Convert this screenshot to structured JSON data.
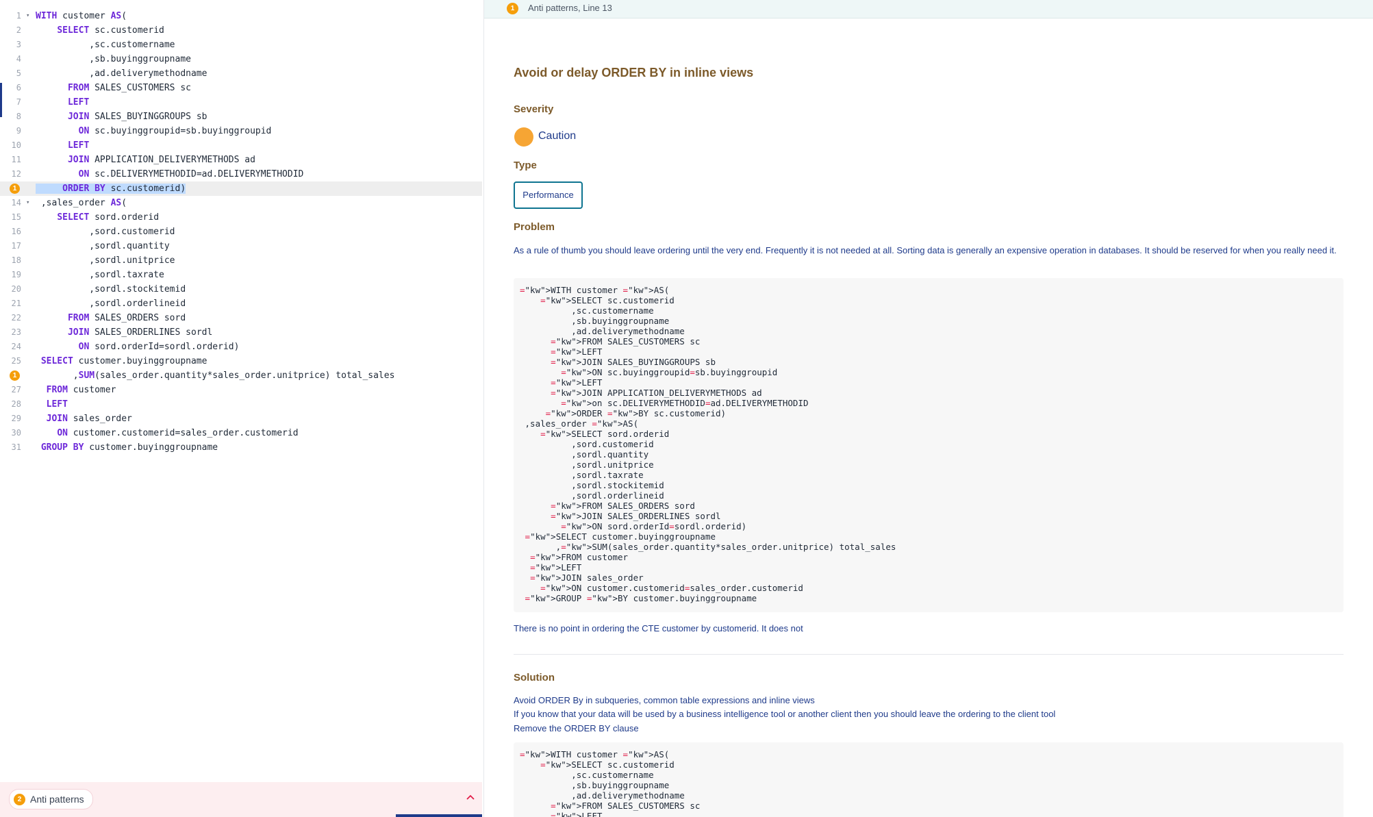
{
  "editor": {
    "lines": [
      {
        "n": "1",
        "code": "WITH customer AS(",
        "fold": true
      },
      {
        "n": "2",
        "code": "    SELECT sc.customerid"
      },
      {
        "n": "3",
        "code": "          ,sc.customername"
      },
      {
        "n": "4",
        "code": "          ,sb.buyinggroupname"
      },
      {
        "n": "5",
        "code": "          ,ad.deliverymethodname"
      },
      {
        "n": "6",
        "code": "      FROM SALES_CUSTOMERS sc"
      },
      {
        "n": "7",
        "code": "      LEFT"
      },
      {
        "n": "8",
        "code": "      JOIN SALES_BUYINGGROUPS sb"
      },
      {
        "n": "9",
        "code": "        ON sc.buyinggroupid=sb.buyinggroupid"
      },
      {
        "n": "10",
        "code": "      LEFT"
      },
      {
        "n": "11",
        "code": "      JOIN APPLICATION_DELIVERYMETHODS ad"
      },
      {
        "n": "12",
        "code": "        ON sc.DELIVERYMETHODID=ad.DELIVERYMETHODID"
      },
      {
        "n": "",
        "code": "     ORDER BY sc.customerid)",
        "warn": "1",
        "hl": true
      },
      {
        "n": "14",
        "code": " ,sales_order AS(",
        "fold": true
      },
      {
        "n": "15",
        "code": "    SELECT sord.orderid"
      },
      {
        "n": "16",
        "code": "          ,sord.customerid"
      },
      {
        "n": "17",
        "code": "          ,sordl.quantity"
      },
      {
        "n": "18",
        "code": "          ,sordl.unitprice"
      },
      {
        "n": "19",
        "code": "          ,sordl.taxrate"
      },
      {
        "n": "20",
        "code": "          ,sordl.stockitemid"
      },
      {
        "n": "21",
        "code": "          ,sordl.orderlineid"
      },
      {
        "n": "22",
        "code": "      FROM SALES_ORDERS sord"
      },
      {
        "n": "23",
        "code": "      JOIN SALES_ORDERLINES sordl"
      },
      {
        "n": "24",
        "code": "        ON sord.orderId=sordl.orderid)"
      },
      {
        "n": "25",
        "code": " SELECT customer.buyinggroupname"
      },
      {
        "n": "",
        "code": "       ,SUM(sales_order.quantity*sales_order.unitprice) total_sales",
        "warn": "1"
      },
      {
        "n": "27",
        "code": "  FROM customer"
      },
      {
        "n": "28",
        "code": "  LEFT"
      },
      {
        "n": "29",
        "code": "  JOIN sales_order"
      },
      {
        "n": "30",
        "code": "    ON customer.customerid=sales_order.customerid"
      },
      {
        "n": "31",
        "code": " GROUP BY customer.buyinggroupname"
      }
    ]
  },
  "bottom": {
    "badge": "2",
    "label": "Anti patterns",
    "collapse_icon": "chevron-up-icon"
  },
  "detail": {
    "header": {
      "badge": "1",
      "text": "Anti patterns, Line 13"
    },
    "title": "Avoid or delay ORDER BY in inline views",
    "severity_heading": "Severity",
    "severity_label": "Caution",
    "severity_color": "#f6a534",
    "type_heading": "Type",
    "type_label": "Performance",
    "problem_heading": "Problem",
    "problem_text": "As a rule of thumb you should leave ordering until the very end. Frequently it is not needed at all. Sorting data is generally an expensive operation in databases. It should be reserved for when you really need it.",
    "problem_code": [
      "WITH customer AS(",
      "    SELECT sc.customerid",
      "          ,sc.customername",
      "          ,sb.buyinggroupname",
      "          ,ad.deliverymethodname",
      "      FROM SALES_CUSTOMERS sc",
      "      LEFT",
      "      JOIN SALES_BUYINGGROUPS sb",
      "        ON sc.buyinggroupid=sb.buyinggroupid",
      "      LEFT",
      "      JOIN APPLICATION_DELIVERYMETHODS ad",
      "        on sc.DELIVERYMETHODID=ad.DELIVERYMETHODID",
      "     ORDER BY sc.customerid)",
      " ,sales_order AS(",
      "    SELECT sord.orderid",
      "          ,sord.customerid",
      "          ,sordl.quantity",
      "          ,sordl.unitprice",
      "          ,sordl.taxrate",
      "          ,sordl.stockitemid",
      "          ,sordl.orderlineid",
      "      FROM SALES_ORDERS sord",
      "      JOIN SALES_ORDERLINES sordl",
      "        ON sord.orderId=sordl.orderid)",
      " SELECT customer.buyinggroupname",
      "       ,SUM(sales_order.quantity*sales_order.unitprice) total_sales",
      "  FROM customer",
      "  LEFT",
      "  JOIN sales_order",
      "    ON customer.customerid=sales_order.customerid",
      " GROUP BY customer.buyinggroupname"
    ],
    "problem_note": "There is no point in ordering the CTE customer by customerid. It does not",
    "solution_heading": "Solution",
    "solution_lines": [
      "Avoid ORDER By in subqueries, common table expressions and inline views",
      "If you know that your data will be used by a business intelligence tool or another client then you should leave the ordering to the client tool",
      "Remove the ORDER BY clause"
    ],
    "solution_code": [
      "WITH customer AS(",
      "    SELECT sc.customerid",
      "          ,sc.customername",
      "          ,sb.buyinggroupname",
      "          ,ad.deliverymethodname",
      "      FROM SALES_CUSTOMERS sc",
      "      LEFT"
    ]
  }
}
